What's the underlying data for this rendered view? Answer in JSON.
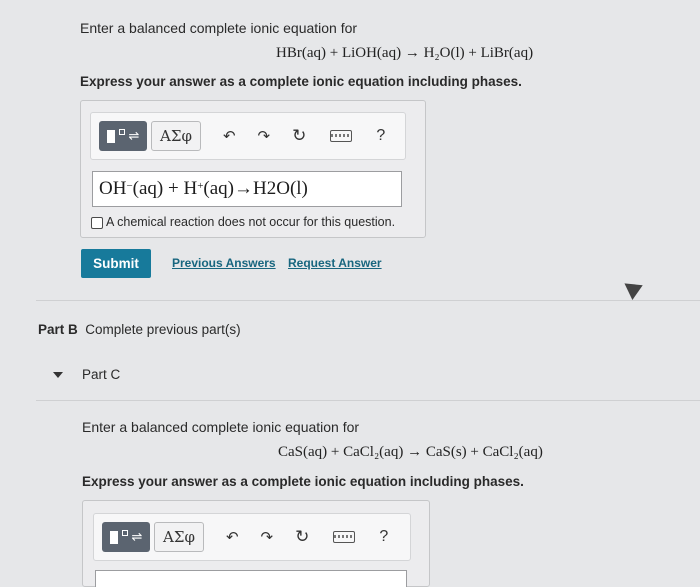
{
  "part_a": {
    "prompt": "Enter a balanced complete ionic equation for",
    "equation": "HBr(aq) + LiOH(aq) → H₂O(l) + LiBr(aq)",
    "instruction": "Express your answer as a complete ionic equation including phases.",
    "toolbar": {
      "greek_label": "ΑΣφ",
      "undo": "↶",
      "redo": "↷",
      "reset": "↻",
      "help": "?"
    },
    "answer": {
      "oh_term": "OH",
      "oh_charge": "−",
      "oh_phase": " (aq) + H",
      "h_charge": "+",
      "rest": " (aq)→H2O(l)"
    },
    "no_reaction_label": "A chemical reaction does not occur for this question.",
    "submit_label": "Submit",
    "previous_answers_label": "Previous Answers",
    "request_answer_label": "Request Answer"
  },
  "part_b": {
    "label": "Part B",
    "text": "Complete previous part(s)"
  },
  "part_c": {
    "label": "Part C",
    "prompt": "Enter a balanced complete ionic equation for",
    "equation": "CaS(aq) + CaCl₂(aq) → CaS(s) + CaCl₂(aq)",
    "instruction": "Express your answer as a complete ionic equation including phases.",
    "toolbar": {
      "greek_label": "ΑΣφ",
      "undo": "↶",
      "redo": "↷",
      "reset": "↻",
      "help": "?"
    }
  }
}
